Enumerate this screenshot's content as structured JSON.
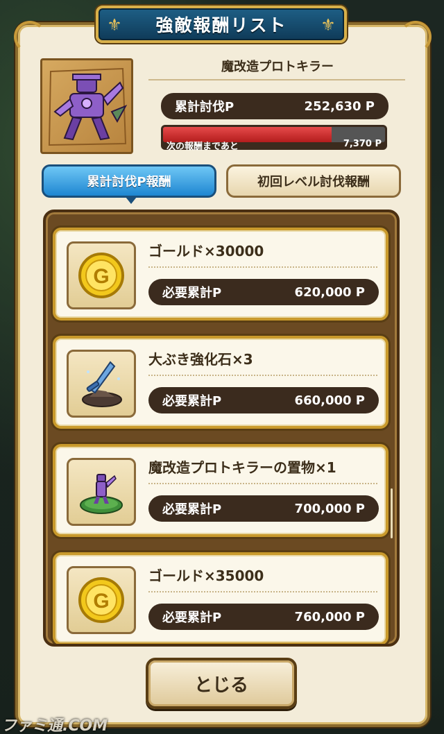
{
  "header": {
    "title": "強敵報酬リスト"
  },
  "boss": {
    "name": "魔改造プロトキラー",
    "total_label": "累計討伐P",
    "total_value": "252,630 P",
    "next_label": "次の報酬まであと",
    "next_value": "7,370 P",
    "progress": 0.76
  },
  "tabs": [
    {
      "label": "累計討伐P報酬",
      "active": true
    },
    {
      "label": "初回レベル討伐報酬",
      "active": false
    }
  ],
  "rewards": [
    {
      "name": "ゴールド×30000",
      "req_label": "必要累計P",
      "req_value": "620,000 P",
      "icon": "gold-coin-icon"
    },
    {
      "name": "大ぶき強化石×3",
      "req_label": "必要累計P",
      "req_value": "660,000 P",
      "icon": "weapon-upgrade-stone-icon"
    },
    {
      "name": "魔改造プロトキラーの置物×1",
      "req_label": "必要累計P",
      "req_value": "700,000 P",
      "icon": "figurine-icon"
    },
    {
      "name": "ゴールド×35000",
      "req_label": "必要累計P",
      "req_value": "760,000 P",
      "icon": "gold-coin-icon"
    }
  ],
  "close_button": {
    "label": "とじる"
  },
  "watermark": "ファミ通.COM",
  "colors": {
    "accent_blue": "#1e86d1",
    "progress_red": "#d62e2e",
    "frame_gold": "#c99a2c",
    "pill_dark": "#3b2b1e"
  }
}
